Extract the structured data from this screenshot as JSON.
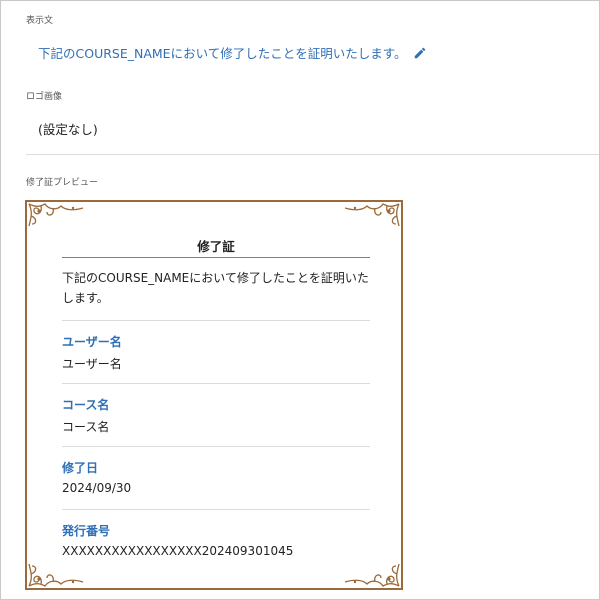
{
  "display_text": {
    "label": "表示文",
    "sentence": "下記のCOURSE_NAMEにおいて修了したことを証明いたします。"
  },
  "logo_image": {
    "label": "ロゴ画像",
    "value": "(設定なし)"
  },
  "preview": {
    "label": "修了証プレビュー",
    "title": "修了証",
    "body": "下記のCOURSE_NAMEにおいて修了したことを証明いたします。",
    "fields": [
      {
        "label": "ユーザー名",
        "value": "ユーザー名"
      },
      {
        "label": "コース名",
        "value": "コース名"
      },
      {
        "label": "修了日",
        "value": "2024/09/30"
      },
      {
        "label": "発行番号",
        "value": "XXXXXXXXXXXXXXXXX202409301045"
      }
    ]
  },
  "colors": {
    "link_blue": "#2f6fb5",
    "border_brown": "#9b6a3a",
    "title_rule_blue": "#4a8fc6"
  },
  "icons": {
    "edit": "pencil-icon",
    "ornament": "corner-ornament-icon"
  }
}
